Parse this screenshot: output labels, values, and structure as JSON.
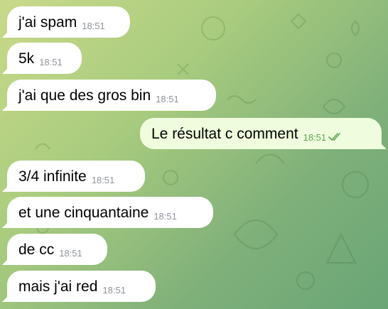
{
  "colors": {
    "incoming_bubble": "#ffffff",
    "outgoing_bubble": "#effdde",
    "time_incoming": "#8e9399",
    "time_outgoing": "#5ea650",
    "background_start": "#c9d98a",
    "background_end": "#6aa576"
  },
  "messages": [
    {
      "direction": "incoming",
      "text": "j'ai spam",
      "time": "18:51"
    },
    {
      "direction": "incoming",
      "text": "5k",
      "time": "18:51"
    },
    {
      "direction": "incoming",
      "text": "j'ai que des gros bin",
      "time": "18:51"
    },
    {
      "direction": "outgoing",
      "text": "Le résultat c comment",
      "time": "18:51",
      "status_icon": "double-check-icon"
    },
    {
      "direction": "incoming",
      "text": "3/4 infinite",
      "time": "18:51"
    },
    {
      "direction": "incoming",
      "text": "et une cinquantaine",
      "time": "18:51"
    },
    {
      "direction": "incoming",
      "text": "de cc",
      "time": "18:51"
    },
    {
      "direction": "incoming",
      "text": "mais j'ai red",
      "time": "18:51"
    }
  ]
}
